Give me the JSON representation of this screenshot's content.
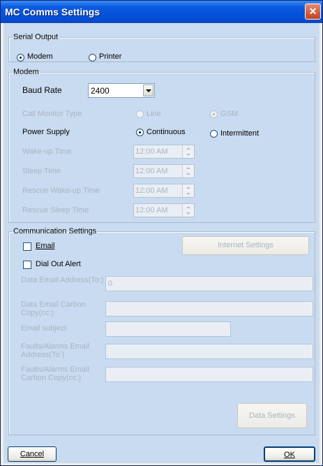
{
  "window": {
    "title": "MC Comms Settings",
    "close_label": "✕"
  },
  "serial_output": {
    "legend": "Serial Output",
    "options": [
      {
        "label": "Modem",
        "checked": true
      },
      {
        "label": "Printer",
        "checked": false
      }
    ]
  },
  "modem": {
    "legend": "Modem",
    "baud_rate_label": "Baud Rate",
    "baud_rate_value": "2400",
    "call_monitor_label": "Call Monitor Type",
    "call_monitor_options": [
      {
        "label": "Line",
        "checked": false
      },
      {
        "label": "GSM",
        "checked": true
      }
    ],
    "power_supply_label": "Power Supply",
    "power_supply_options": [
      {
        "label": "Continuous",
        "checked": true
      },
      {
        "label": "Intermittent",
        "checked": false
      }
    ],
    "times": [
      {
        "label": "Wake-up Time",
        "value": "12:00 AM"
      },
      {
        "label": "Sleep Time",
        "value": "12:00 AM"
      },
      {
        "label": "Rescue Wake-up Time",
        "value": "12:00 AM"
      },
      {
        "label": "Rescue Sleep Time",
        "value": "12:00 AM"
      }
    ]
  },
  "communication": {
    "legend": "Communication Settings",
    "email_label": "Email",
    "dial_out_label": "Dial Out Alert",
    "internet_settings_label": "Internet Settings",
    "fields": [
      {
        "label": "Data Email Address(To:)",
        "value": "0"
      },
      {
        "label": "Data Email Carbon Copy(cc:)",
        "value": ""
      },
      {
        "label": "Email subject",
        "value": ""
      },
      {
        "label": "Faults/Alarms Email Address(To:)",
        "value": ""
      },
      {
        "label": "Faults/Alarms Email Carbon Copy(cc:)",
        "value": ""
      }
    ],
    "data_settings_label": "Data Settings"
  },
  "footer": {
    "cancel_label": "Cancel",
    "ok_label": "OK"
  }
}
